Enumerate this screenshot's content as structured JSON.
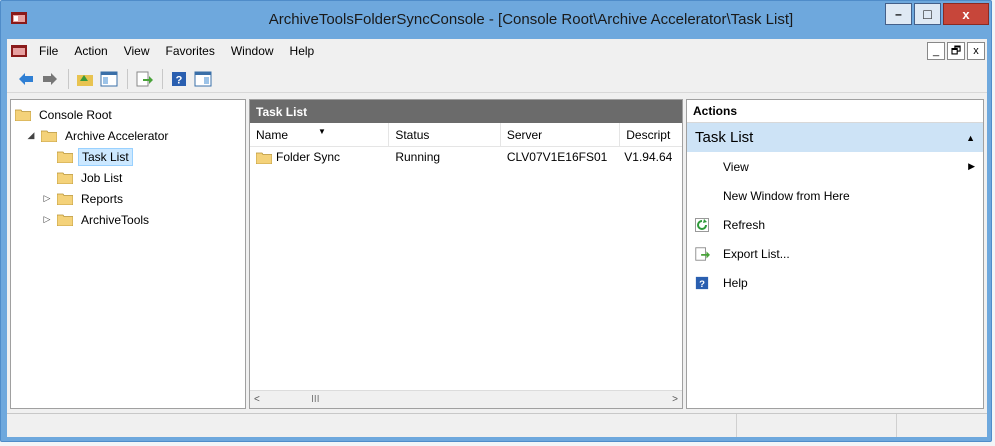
{
  "window": {
    "title": "ArchiveToolsFolderSyncConsole - [Console Root\\Archive Accelerator\\Task List]",
    "minimize": "–",
    "maximize": "□",
    "close": "x"
  },
  "menu": {
    "items": [
      "File",
      "Action",
      "View",
      "Favorites",
      "Window",
      "Help"
    ],
    "mdi_minimize": "_",
    "mdi_restore": "🗗",
    "mdi_close": "x"
  },
  "tree": {
    "root": "Console Root",
    "items": [
      {
        "label": "Archive Accelerator",
        "expander": "◢"
      },
      {
        "label": "Task List",
        "selected": true
      },
      {
        "label": "Job List"
      },
      {
        "label": "Reports",
        "expander": "▷"
      },
      {
        "label": "ArchiveTools",
        "expander": "▷"
      }
    ]
  },
  "center": {
    "header": "Task List",
    "columns": [
      "Name",
      "Status",
      "Server",
      "Descript"
    ],
    "rows": [
      {
        "name": "Folder Sync",
        "status": "Running",
        "server": "CLV07V1E16FS01",
        "desc": "V1.94.64"
      }
    ],
    "scroll_left": "<",
    "scroll_thumb": "III",
    "scroll_right": ">"
  },
  "actions": {
    "header": "Actions",
    "section": "Task List",
    "items": [
      "View",
      "New Window from Here",
      "Refresh",
      "Export List...",
      "Help"
    ]
  },
  "colors": {
    "frame": "#6ea8dd",
    "selected_bg": "#cce8ff",
    "action_section_bg": "#cde3f6",
    "pane_header_bg": "#6b6b6b"
  }
}
